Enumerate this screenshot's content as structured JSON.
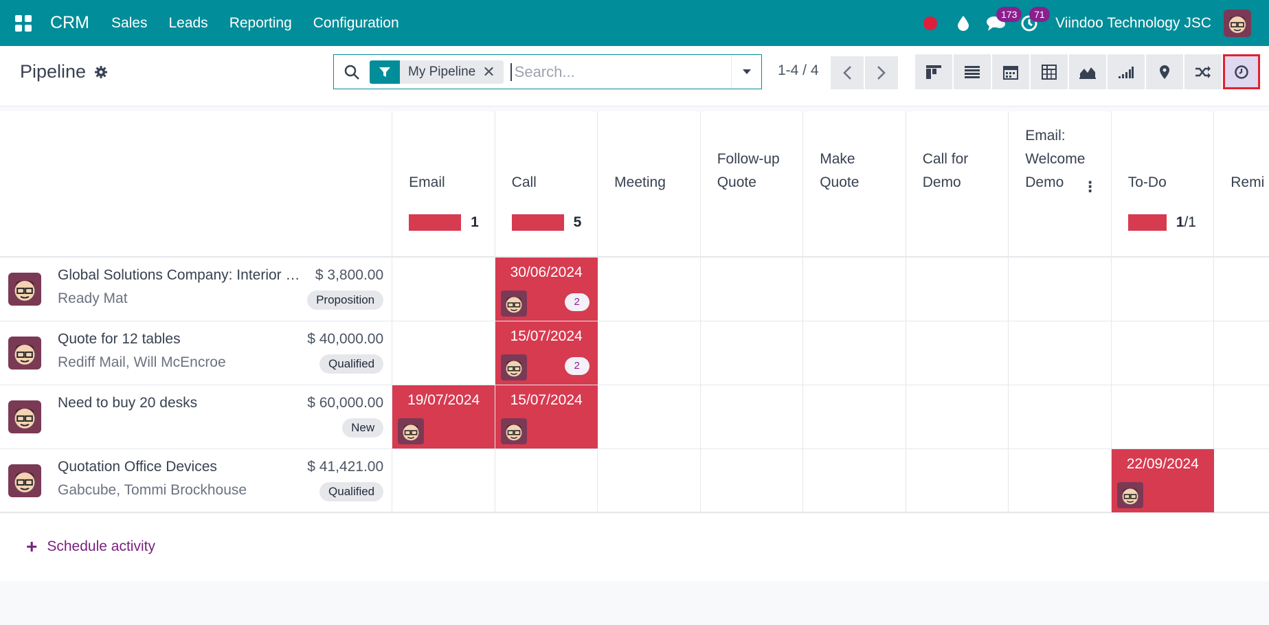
{
  "nav": {
    "brand": "CRM",
    "menu": [
      "Sales",
      "Leads",
      "Reporting",
      "Configuration"
    ],
    "messages_count": "173",
    "activities_count": "71",
    "company": "Viindoo Technology JSC"
  },
  "control": {
    "title": "Pipeline",
    "facet_label": "My Pipeline",
    "search_placeholder": "Search...",
    "pager": "1-4 / 4",
    "views": [
      "kanban-icon",
      "list-icon",
      "calendar-icon",
      "pivot-icon",
      "graph-icon",
      "cohort-icon",
      "map-icon",
      "flow-icon",
      "activity-icon"
    ],
    "active_view": "activity-icon"
  },
  "activity_types": [
    {
      "name": "Email",
      "bar_fraction": 1.0,
      "count": "1",
      "total": ""
    },
    {
      "name": "Call",
      "bar_fraction": 1.0,
      "count": "5",
      "total": ""
    },
    {
      "name": "Meeting",
      "bar_fraction": 0,
      "count": "",
      "total": ""
    },
    {
      "name": "Follow-up Quote",
      "bar_fraction": 0,
      "count": "",
      "total": ""
    },
    {
      "name": "Make Quote",
      "bar_fraction": 0,
      "count": "",
      "total": ""
    },
    {
      "name": "Call for Demo",
      "bar_fraction": 0,
      "count": "",
      "total": ""
    },
    {
      "name": "Email: Welcome Demo",
      "bar_fraction": 0,
      "count": "",
      "total": ""
    },
    {
      "name": "To-Do",
      "bar_fraction": 1.0,
      "count": "1",
      "total": "/1"
    },
    {
      "name": "Remi",
      "bar_fraction": 0,
      "count": "",
      "total": ""
    }
  ],
  "records": [
    {
      "name": "Global Solutions Company: Interior Design",
      "sub": "Ready Mat",
      "amount": "$ 3,800.00",
      "stage": "Proposition",
      "activities": {
        "1": {
          "date": "30/06/2024",
          "count": "2"
        }
      }
    },
    {
      "name": "Quote for 12 tables",
      "sub": "Rediff Mail, Will McEncroe",
      "amount": "$ 40,000.00",
      "stage": "Qualified",
      "activities": {
        "1": {
          "date": "15/07/2024",
          "count": "2"
        }
      }
    },
    {
      "name": "Need to buy 20 desks",
      "sub": "",
      "amount": "$ 60,000.00",
      "stage": "New",
      "activities": {
        "0": {
          "date": "19/07/2024",
          "count": ""
        },
        "1": {
          "date": "15/07/2024",
          "count": ""
        }
      }
    },
    {
      "name": "Quotation Office Devices",
      "sub": "Gabcube, Tommi Brockhouse",
      "amount": "$ 41,421.00",
      "stage": "Qualified",
      "activities": {
        "7": {
          "date": "22/09/2024",
          "count": ""
        }
      }
    }
  ],
  "footer": {
    "schedule_label": "Schedule activity"
  }
}
